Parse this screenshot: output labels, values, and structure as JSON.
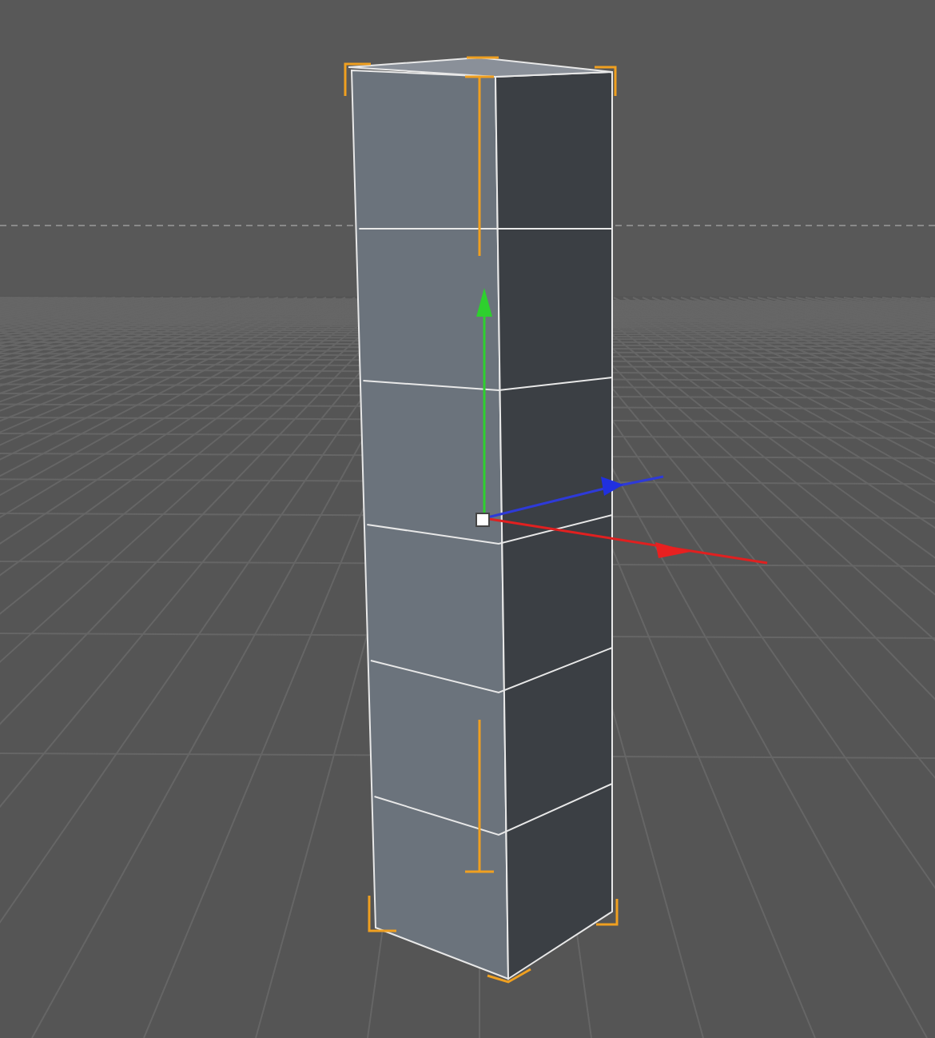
{
  "viewport": {
    "object_selected": true
  }
}
